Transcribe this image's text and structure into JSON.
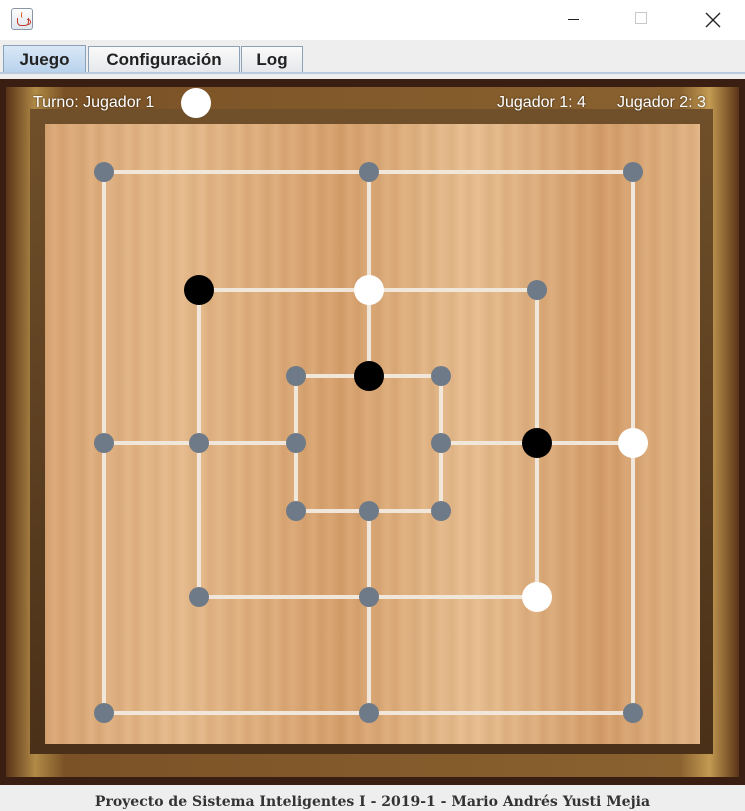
{
  "window": {
    "app_icon": "java-cup-icon",
    "controls": {
      "minimize": "minimize-icon",
      "maximize": "maximize-icon",
      "close": "close-icon"
    }
  },
  "tabs": [
    {
      "label": "Juego",
      "active": true
    },
    {
      "label": "Configuración",
      "active": false
    },
    {
      "label": "Log",
      "active": false
    }
  ],
  "hud": {
    "turn_label": "Turno: Jugador 1",
    "turn_piece_color": "white",
    "score_player1": "Jugador 1: 4",
    "score_player2": "Jugador 2: 3"
  },
  "board": {
    "line_color": "#f0e6da",
    "empty_point_color": "#6f7a88",
    "white_piece_color": "#ffffff",
    "black_piece_color": "#000000",
    "points": {
      "outer_square": [
        "empty",
        "empty",
        "empty",
        "empty",
        "white",
        "empty",
        "empty",
        "empty"
      ],
      "middle_square": [
        "black",
        "white",
        "empty",
        "empty",
        "black",
        "empty",
        "empty",
        "white"
      ],
      "inner_square": [
        "empty",
        "black",
        "empty",
        "empty",
        "empty",
        "empty",
        "empty",
        "empty"
      ]
    }
  },
  "footer": {
    "text": "Proyecto de Sistema Inteligentes I - 2019-1 - Mario Andrés Yusti Mejia"
  }
}
